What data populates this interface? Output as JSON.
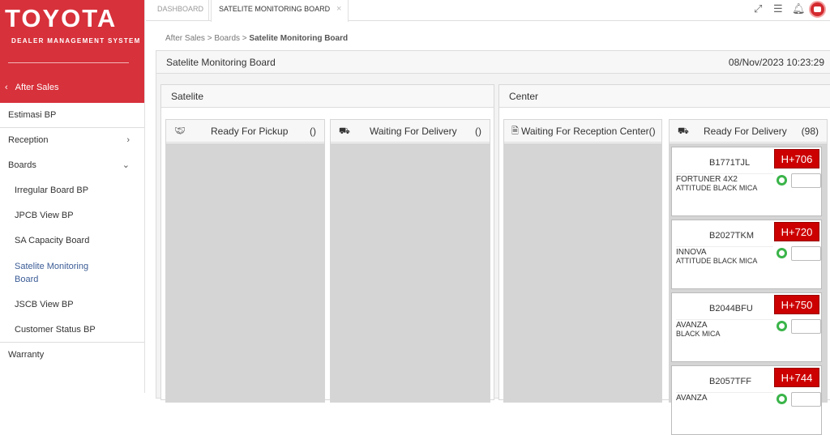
{
  "brand": {
    "logo": "TOYOTA",
    "subtitle": "DEALER MANAGEMENT SYSTEM",
    "section": "After Sales",
    "section_icon": "chevron-left-icon"
  },
  "sidebar": {
    "items": [
      {
        "label": "Estimasi BP"
      },
      {
        "label": "Reception",
        "caret": "›"
      },
      {
        "label": "Boards",
        "caret": "⌄"
      },
      {
        "label": "Irregular Board BP"
      },
      {
        "label": "JPCB View BP"
      },
      {
        "label": "SA Capacity Board"
      },
      {
        "label": "Satelite Monitoring Board"
      },
      {
        "label": "JSCB View BP"
      },
      {
        "label": "Customer Status BP"
      },
      {
        "label": "Warranty"
      }
    ]
  },
  "tabs": [
    {
      "label": "DASHBOARD"
    },
    {
      "label": "SATELITE MONITORING BOARD",
      "close": "×"
    }
  ],
  "topbar_icons": [
    "expand-icon",
    "menu-icon",
    "bell-icon",
    "avatar-icon"
  ],
  "breadcrumb": {
    "a": "After Sales",
    "b": "Boards",
    "c": "Satelite Monitoring Board",
    "sep": ">"
  },
  "board": {
    "title": "Satelite Monitoring Board",
    "datetime": "08/Nov/2023 10:23:29"
  },
  "satelite": {
    "title": "Satelite",
    "pickup": {
      "label": "Ready For Pickup",
      "count": "()",
      "icon": "handshake-icon"
    },
    "waiting": {
      "label": "Waiting For Delivery",
      "count": "()",
      "icon": "truck-icon"
    }
  },
  "center": {
    "title": "Center",
    "reception": {
      "label": "Waiting For Reception Center()",
      "icon": "document-icon"
    },
    "ready": {
      "label": "Ready For Delivery",
      "count": "(98)",
      "icon": "truck-icon"
    },
    "cards": [
      {
        "plate": "B1771TJL",
        "badge": "H+706",
        "model": "FORTUNER 4X2",
        "color": "ATTITUDE BLACK MICA"
      },
      {
        "plate": "B2027TKM",
        "badge": "H+720",
        "model": "INNOVA",
        "color": "ATTITUDE BLACK MICA"
      },
      {
        "plate": "B2044BFU",
        "badge": "H+750",
        "model": "AVANZA",
        "color": "BLACK MICA"
      },
      {
        "plate": "B2057TFF",
        "badge": "H+744",
        "model": "AVANZA",
        "color": ""
      }
    ]
  },
  "colors": {
    "brand": "#d7313b",
    "badge": "#cc0000",
    "active_link": "#3b5c96"
  }
}
